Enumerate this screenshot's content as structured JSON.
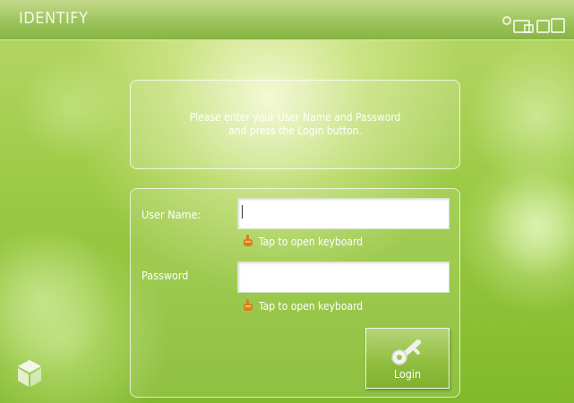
{
  "header": {
    "title": "IDENTIFY"
  },
  "status_icons": [
    "circle-icon",
    "window-icon",
    "window-icon",
    "window-icon"
  ],
  "message": {
    "text": "Please enter your User Name and Password\nand press the Login button."
  },
  "form": {
    "username": {
      "label": "User Name:",
      "value": "",
      "hint": "Tap to open keyboard"
    },
    "password": {
      "label": "Password",
      "value": "",
      "hint": "Tap to open keyboard"
    }
  },
  "login_button": {
    "label": "Login",
    "icon": "key-icon"
  },
  "logo": {
    "icon": "cube-logo-icon"
  },
  "colors": {
    "accent_green": "#8fbd3d",
    "hint_icon_orange": "#e07a1f"
  }
}
